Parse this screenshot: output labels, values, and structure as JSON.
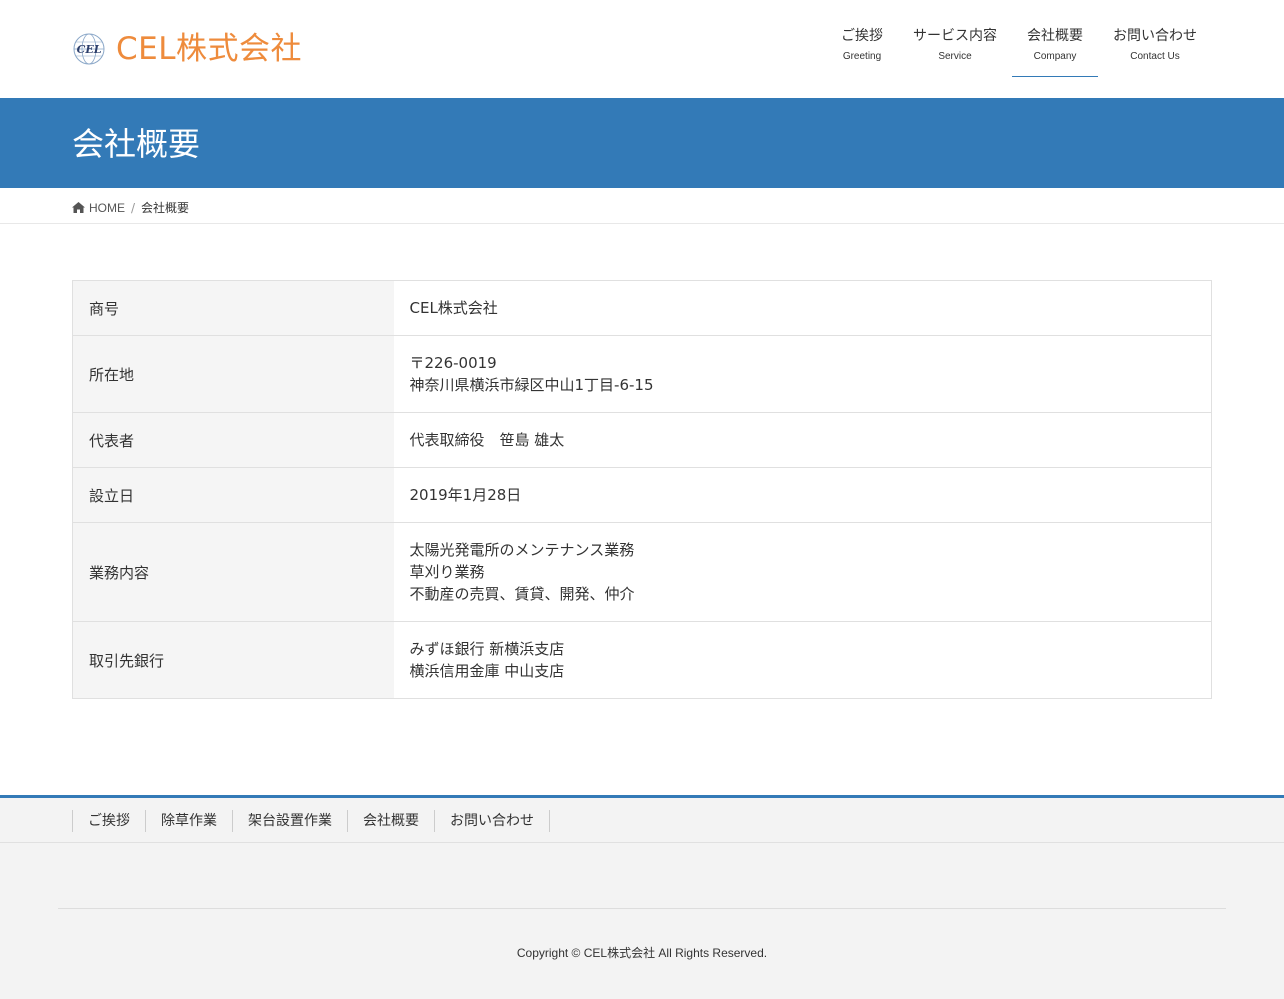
{
  "header": {
    "logo_text": "CEL株式会社",
    "logo_mark_text": "CEL",
    "nav": [
      {
        "ja": "ご挨拶",
        "en": "Greeting"
      },
      {
        "ja": "サービス内容",
        "en": "Service"
      },
      {
        "ja": "会社概要",
        "en": "Company"
      },
      {
        "ja": "お問い合わせ",
        "en": "Contact Us"
      }
    ],
    "active_nav": "会社概要"
  },
  "page_title": "会社概要",
  "breadcrumb": {
    "home": "HOME",
    "separator": "/",
    "current": "会社概要"
  },
  "company": {
    "rows": [
      {
        "label": "商号",
        "lines": [
          "CEL株式会社"
        ]
      },
      {
        "label": "所在地",
        "lines": [
          "〒226-0019",
          "神奈川県横浜市緑区中山1丁目-6-15"
        ]
      },
      {
        "label": "代表者",
        "lines": [
          "代表取締役　笹島 雄太"
        ]
      },
      {
        "label": "設立日",
        "lines": [
          "2019年1月28日"
        ]
      },
      {
        "label": "業務内容",
        "lines": [
          "太陽光発電所のメンテナンス業務",
          "草刈り業務",
          "不動産の売買、賃貸、開発、仲介"
        ]
      },
      {
        "label": "取引先銀行",
        "lines": [
          "みずほ銀行 新横浜支店",
          "横浜信用金庫 中山支店"
        ]
      }
    ]
  },
  "footer": {
    "links": [
      "ご挨拶",
      "除草作業",
      "架台設置作業",
      "会社概要",
      "お問い合わせ"
    ],
    "copyright": "Copyright © CEL株式会社 All Rights Reserved."
  },
  "colors": {
    "accent": "#337ab7",
    "logo": "#ee8b3c",
    "table_header_bg": "#f5f5f5",
    "footer_bg": "#f3f3f3"
  },
  "icons": {
    "home": "home-icon",
    "logo": "globe-logo-icon"
  }
}
